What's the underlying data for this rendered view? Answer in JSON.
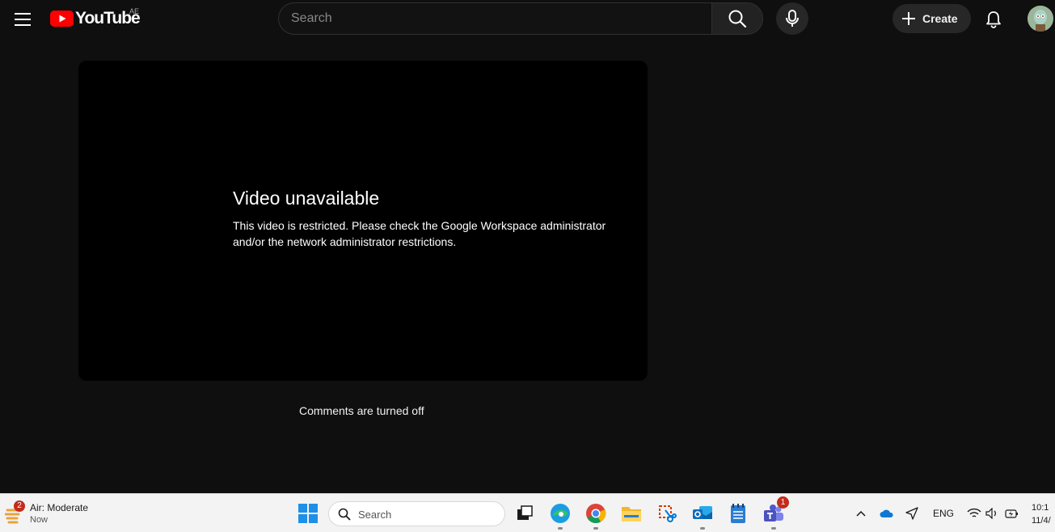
{
  "header": {
    "logo_text": "YouTube",
    "country_code": "AE",
    "search_placeholder": "Search",
    "create_label": "Create",
    "icons": [
      "hamburger-menu-icon",
      "youtube-play-icon",
      "search-icon",
      "microphone-icon",
      "plus-icon",
      "bell-icon"
    ]
  },
  "player": {
    "error_title": "Video unavailable",
    "error_message": "This video is restricted. Please check the Google Workspace administrator and/or the network administrator restrictions."
  },
  "comments": {
    "status_text": "Comments are turned off"
  },
  "colors": {
    "background": "#0f0f0f",
    "youtube_red": "#ff0000",
    "taskbar": "#f3f3f3",
    "badge_red": "#c42b1c"
  },
  "taskbar": {
    "weather": {
      "badge": "2",
      "title": "Air: Moderate",
      "subtitle": "Now"
    },
    "search_label": "Search",
    "apps": [
      {
        "name": "task-view"
      },
      {
        "name": "edge"
      },
      {
        "name": "chrome"
      },
      {
        "name": "file-explorer"
      },
      {
        "name": "snipping-tool"
      },
      {
        "name": "outlook"
      },
      {
        "name": "notepad"
      },
      {
        "name": "teams",
        "badge": "1"
      }
    ],
    "tray": {
      "language": "ENG"
    },
    "clock": {
      "time": "10:1",
      "date": "11/4/"
    }
  }
}
